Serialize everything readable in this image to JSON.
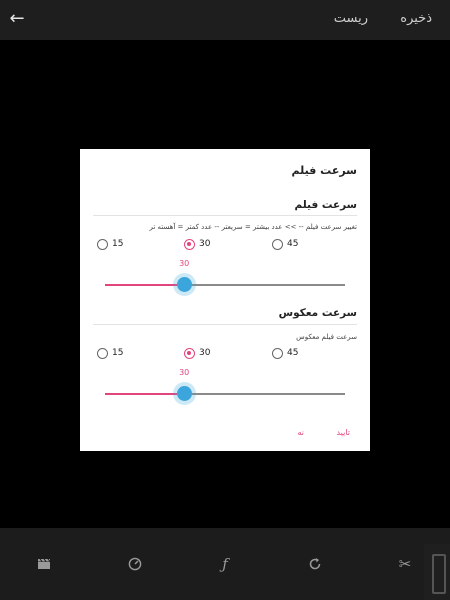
{
  "topbar": {
    "back_icon": "arrow-left-icon",
    "save_label": "ذخیره",
    "reset_label": "ریست"
  },
  "dialog": {
    "title": "سرعت فیلم",
    "speed_section": {
      "title": "سرعت فیلم",
      "description": "تغییر سرعت فیلم -- >> عدد بیشتر = سریعتر  --  عدد کمتر = آهسته تر",
      "options": [
        "15",
        "30",
        "45"
      ],
      "selected": "30",
      "slider_value": "30",
      "slider_fraction": 0.33
    },
    "reverse_section": {
      "title": "سرعت معکوس",
      "description": "سرعت فیلم معکوس",
      "options": [
        "15",
        "30",
        "45"
      ],
      "selected": "30",
      "slider_value": "30",
      "slider_fraction": 0.33
    },
    "confirm_label": "تایید",
    "cancel_label": "نه"
  },
  "bottombar": {
    "tools": [
      "clapperboard-icon",
      "speedometer-icon",
      "function-icon",
      "rotate-icon",
      "scissors-icon"
    ]
  },
  "colors": {
    "accent": "#e2457e",
    "thumb": "#3da6dc",
    "topbar_bg": "#1e1e1e",
    "bottombar_bg": "#1c1c1c"
  }
}
